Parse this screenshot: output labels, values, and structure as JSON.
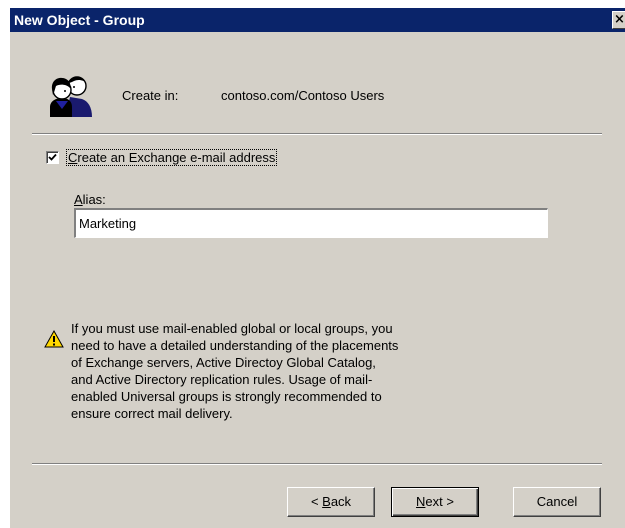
{
  "window": {
    "title": "New Object - Group",
    "close_glyph": "×"
  },
  "header": {
    "icon": "group-icon",
    "create_in_label": "Create in:",
    "create_in_value": "contoso.com/Contoso Users"
  },
  "exchange": {
    "checkbox_checked": true,
    "checkbox_label_mnemonic": "C",
    "checkbox_label_rest": "reate an Exchange e-mail address",
    "alias_label_mnemonic": "A",
    "alias_label_rest": "lias:",
    "alias_value": "Marketing"
  },
  "warning": {
    "icon": "warning-icon",
    "text": "If you must use mail-enabled global or local groups, you need to have a detailed understanding of the placements of Exchange servers, Active Directoy Global Catalog, and Active Directory replication rules. Usage of mail-enabled Universal groups is strongly recommended to ensure correct mail delivery."
  },
  "buttons": {
    "back_prefix": "< ",
    "back_mnemonic": "B",
    "back_rest": "ack",
    "next_mnemonic": "N",
    "next_rest": "ext >",
    "cancel": "Cancel"
  },
  "colors": {
    "title_bar": "#0a246a",
    "dialog_face": "#d4d0c8"
  }
}
